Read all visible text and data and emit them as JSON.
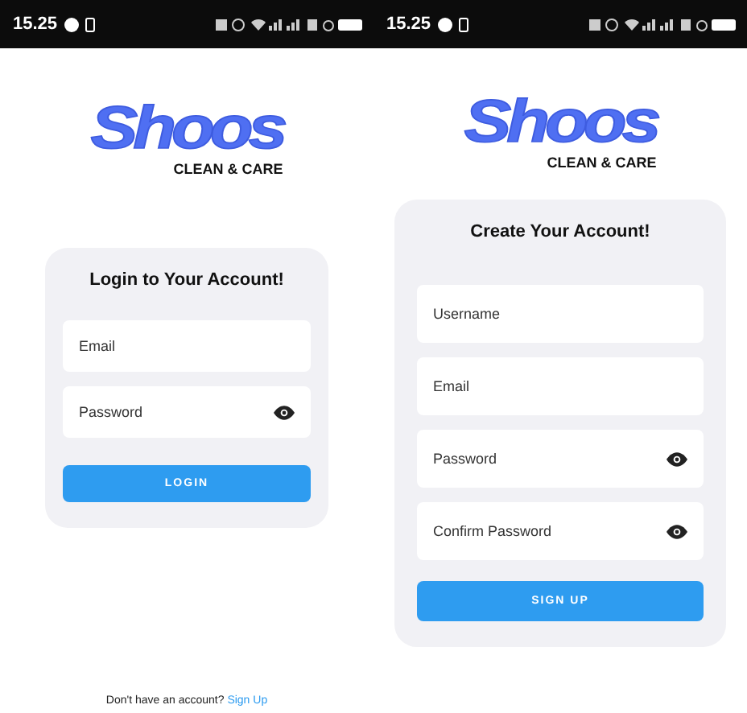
{
  "screens": [
    {
      "kind": "login",
      "status_bar": {
        "time": "15.25"
      },
      "logo": {
        "title": "Shoos",
        "subtitle": "CLEAN & CARE"
      },
      "card": {
        "title": "Login to Your Account!",
        "fields": [
          {
            "placeholder": "Email",
            "kind": "text"
          },
          {
            "placeholder": "Password",
            "kind": "password"
          }
        ],
        "button": "LOGIN"
      },
      "footer": {
        "text": "Don't have an account?",
        "link": "Sign Up"
      }
    },
    {
      "kind": "signup",
      "status_bar": {
        "time": "15.25"
      },
      "logo": {
        "title": "Shoos",
        "subtitle": "CLEAN & CARE"
      },
      "card": {
        "title": "Create Your Account!",
        "fields": [
          {
            "placeholder": "Username",
            "kind": "text"
          },
          {
            "placeholder": "Email",
            "kind": "text"
          },
          {
            "placeholder": "Password",
            "kind": "password"
          },
          {
            "placeholder": "Confirm Password",
            "kind": "password"
          }
        ],
        "button": "SIGN UP"
      }
    }
  ]
}
